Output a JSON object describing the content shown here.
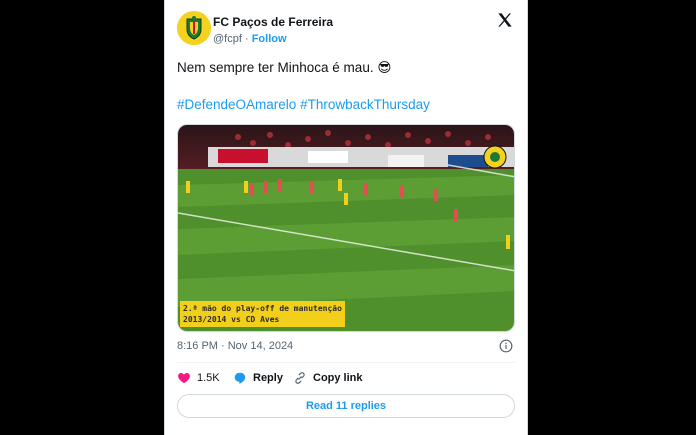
{
  "account": {
    "name": "FC Paços de Ferreira",
    "handle": "@fcpf",
    "separator": "·",
    "follow_label": "Follow"
  },
  "tweet": {
    "text": "Nem sempre ter Minhoca é mau. 😎",
    "hashtags": "#DefendeOAmarelo #ThrowbackThursday"
  },
  "media": {
    "caption_line1": "2.ª mão do play-off de manutenção",
    "caption_line2": "2013/2014 vs CD Aves"
  },
  "meta": {
    "timestamp": "8:16 PM · Nov 14, 2024"
  },
  "actions": {
    "likes": "1.5K",
    "reply_label": "Reply",
    "copy_link_label": "Copy link"
  },
  "replies_button": "Read 11 replies",
  "colors": {
    "link_blue": "#1d9bf0",
    "heart": "#f91880",
    "club_yellow": "#f4d21f",
    "club_green": "#1d7a35"
  },
  "icons": [
    "x-logo-icon",
    "info-icon",
    "heart-icon",
    "reply-icon",
    "link-icon"
  ]
}
